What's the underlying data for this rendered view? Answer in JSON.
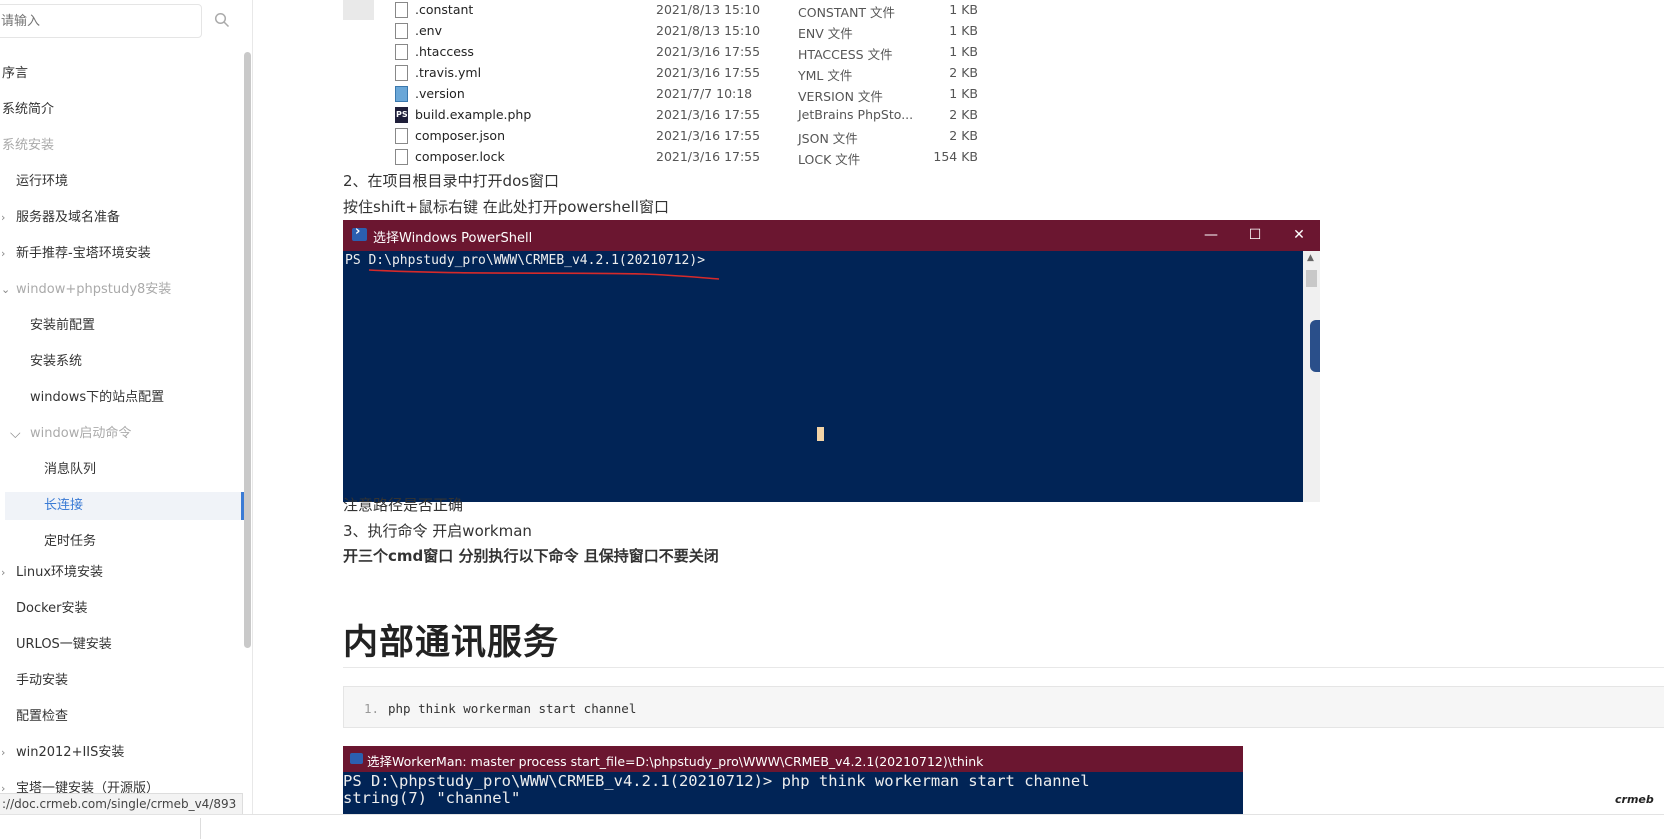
{
  "sidebar": {
    "search_placeholder": "请输入",
    "items": [
      {
        "label": "序言"
      },
      {
        "label": "系统简介"
      },
      {
        "label": "系统安装"
      },
      {
        "label": "运行环境"
      },
      {
        "label": "服务器及域名准备"
      },
      {
        "label": "新手推荐-宝塔环境安装"
      },
      {
        "label": "window+phpstudy8安装"
      },
      {
        "label": "安装前配置"
      },
      {
        "label": "安装系统"
      },
      {
        "label": "windows下的站点配置"
      },
      {
        "label": "window启动命令"
      },
      {
        "label": "消息队列"
      },
      {
        "label": "长连接"
      },
      {
        "label": "定时任务"
      },
      {
        "label": "Linux环境安装"
      },
      {
        "label": "Docker安装"
      },
      {
        "label": "URLOS一键安装"
      },
      {
        "label": "手动安装"
      },
      {
        "label": "配置检查"
      },
      {
        "label": "win2012+IIS安装"
      },
      {
        "label": "宝塔一键安装（开源版）"
      }
    ],
    "active_item": "长连接"
  },
  "status_url": "://doc.crmeb.com/single/crmeb_v4/893",
  "files": [
    {
      "name": ".constant",
      "date": "2021/8/13 15:10",
      "type": "CONSTANT 文件",
      "size": "1 KB",
      "icon": "file-icon"
    },
    {
      "name": ".env",
      "date": "2021/8/13 15:10",
      "type": "ENV 文件",
      "size": "1 KB",
      "icon": "file-icon"
    },
    {
      "name": ".htaccess",
      "date": "2021/3/16 17:55",
      "type": "HTACCESS 文件",
      "size": "1 KB",
      "icon": "file-icon"
    },
    {
      "name": ".travis.yml",
      "date": "2021/3/16 17:55",
      "type": "YML 文件",
      "size": "2 KB",
      "icon": "file-icon"
    },
    {
      "name": ".version",
      "date": "2021/7/7 10:18",
      "type": "VERSION 文件",
      "size": "1 KB",
      "icon": "version-file-icon"
    },
    {
      "name": "build.example.php",
      "date": "2021/3/16 17:55",
      "type": "JetBrains PhpSto...",
      "size": "2 KB",
      "icon": "phpstorm-file-icon"
    },
    {
      "name": "composer.json",
      "date": "2021/3/16 17:55",
      "type": "JSON 文件",
      "size": "2 KB",
      "icon": "file-icon"
    },
    {
      "name": "composer.lock",
      "date": "2021/3/16 17:55",
      "type": "LOCK 文件",
      "size": "154 KB",
      "icon": "file-icon"
    }
  ],
  "content": {
    "step2": "2、在项目根目录中打开dos窗口",
    "step2_hint": "按住shift+鼠标右键 在此处打开powershell窗口",
    "note_path": "注意路径是否正确",
    "step3": "3、执行命令 开启workman",
    "step3_hint": "开三个cmd窗口 分别执行以下命令 且保持窗口不要关闭",
    "heading": "内部通讯服务",
    "code_line_no": "1.",
    "code": "php think workerman start channel"
  },
  "powershell": {
    "title": "选择Windows PowerShell",
    "prompt": "PS D:\\phpstudy_pro\\WWW\\CRMEB_v4.2.1(20210712)>",
    "minimize": "—",
    "maximize": "☐",
    "close": "✕"
  },
  "workerman": {
    "title": "选择WorkerMan: master process  start_file=D:\\phpstudy_pro\\WWW\\CRMEB_v4.2.1(20210712)\\think",
    "line1": "PS D:\\phpstudy_pro\\WWW\\CRMEB_v4.2.1(20210712)> php think workerman start channel",
    "line2": "string(7) \"channel\""
  },
  "brand": "crmeb",
  "colors": {
    "titlebar": "#6b1630",
    "console_bg": "#012456",
    "accent": "#3a7bd5"
  }
}
